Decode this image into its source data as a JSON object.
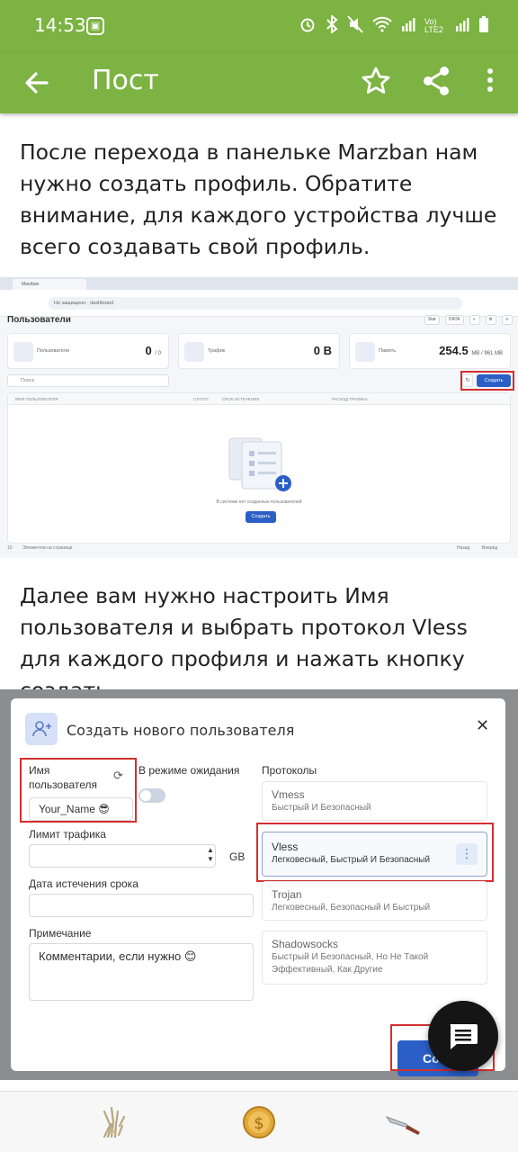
{
  "status_bar": {
    "time": "14:53",
    "network": "Vo) LTE2"
  },
  "app_bar": {
    "title": "Пост",
    "colors": {
      "accent": "#7cb342"
    }
  },
  "paragraphs": [
    "После перехода в панельке Marzban нам нужно создать профиль. Обратите внимание, для каждого устройства лучше всего создавать свой профиль.",
    "Далее вам нужно настроить Имя пользователя и выбрать протокол Vless для каждого профиля и нажать кнопку создать."
  ],
  "screenshot1": {
    "page_title": "Пользователи",
    "cards": [
      {
        "label": "Пользователи",
        "value": "0",
        "suffix": "/ 0"
      },
      {
        "label": "Трафик",
        "value": "0 B",
        "suffix": ""
      },
      {
        "label": "Память",
        "value": "254.5",
        "suffix": "MB / 961 MB"
      }
    ],
    "search_placeholder": "Поиск",
    "create_button": "Создать",
    "columns": [
      "ИМЯ ПОЛЬЗОВАТЕЛЯ",
      "СТАТУС",
      "СРОК ИСТЕЧЕНИЯ",
      "РАСХОД ТРАФИКА"
    ],
    "empty_text": "В системе нет созданных пользователей",
    "empty_button": "Создать",
    "per_page": "10",
    "per_page_label": "Элементов на странице",
    "prev": "Назад",
    "next": "Вперед"
  },
  "screenshot2": {
    "title": "Создать нового пользователя",
    "username_label": "Имя пользователя",
    "username_value": "Your_Name 😎",
    "standby_label": "В режиме ожидания",
    "traffic_label": "Лимит трафика",
    "traffic_unit": "GB",
    "expire_label": "Дата истечения срока",
    "note_label": "Примечание",
    "note_value": "Комментарии, если нужно 😊",
    "protocols_label": "Протоколы",
    "protocols": [
      {
        "name": "Vmess",
        "desc": "Быстрый И Безопасный"
      },
      {
        "name": "Vless",
        "desc": "Легковесный, Быстрый И Безопасный"
      },
      {
        "name": "Trojan",
        "desc": "Легковесный, Безопасный И Быстрый"
      },
      {
        "name": "Shadowsocks",
        "desc": "Быстрый И Безопасный, Но Не Такой Эффективный, Как Другие"
      }
    ],
    "create_button": "Cо"
  },
  "bottom_bar": {
    "icons": [
      "skeleton-hand-icon",
      "gold-coin-icon",
      "knife-icon"
    ]
  }
}
